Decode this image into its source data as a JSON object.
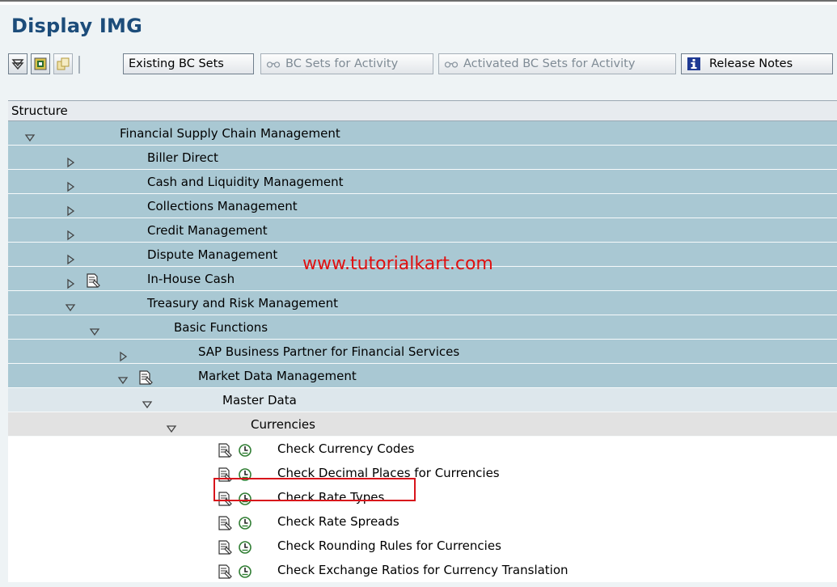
{
  "page_title": "Display IMG",
  "toolbar": {
    "buttons": [
      {
        "label": "Existing BC Sets",
        "enabled": true
      },
      {
        "label": "BC Sets for Activity",
        "enabled": false
      },
      {
        "label": "Activated BC Sets for Activity",
        "enabled": false
      },
      {
        "label": "Release Notes",
        "enabled": true
      }
    ]
  },
  "tree": {
    "header": "Structure",
    "rows": [
      {
        "label": "Financial Supply Chain Management",
        "expanded": true,
        "doc": false,
        "clock": false,
        "level": 0
      },
      {
        "label": "Biller Direct",
        "expanded": false,
        "doc": false,
        "clock": false,
        "level": 1
      },
      {
        "label": "Cash and Liquidity Management",
        "expanded": false,
        "doc": false,
        "clock": false,
        "level": 1
      },
      {
        "label": "Collections Management",
        "expanded": false,
        "doc": false,
        "clock": false,
        "level": 1
      },
      {
        "label": "Credit Management",
        "expanded": false,
        "doc": false,
        "clock": false,
        "level": 1
      },
      {
        "label": "Dispute Management",
        "expanded": false,
        "doc": false,
        "clock": false,
        "level": 1
      },
      {
        "label": "In-House Cash",
        "expanded": false,
        "doc": true,
        "clock": false,
        "level": 1
      },
      {
        "label": "Treasury and Risk Management",
        "expanded": true,
        "doc": false,
        "clock": false,
        "level": 1
      },
      {
        "label": "Basic Functions",
        "expanded": true,
        "doc": false,
        "clock": false,
        "level": 2
      },
      {
        "label": "SAP Business Partner for Financial Services",
        "expanded": false,
        "doc": false,
        "clock": false,
        "level": 3
      },
      {
        "label": "Market Data Management",
        "expanded": true,
        "doc": true,
        "clock": false,
        "level": 3
      },
      {
        "label": "Master Data",
        "expanded": true,
        "doc": false,
        "clock": false,
        "level": 4
      },
      {
        "label": "Currencies",
        "expanded": true,
        "doc": false,
        "clock": false,
        "level": 5
      },
      {
        "label": "Check Currency Codes",
        "doc": true,
        "clock": true,
        "level": 6
      },
      {
        "label": "Check Decimal Places for Currencies",
        "doc": true,
        "clock": true,
        "level": 6
      },
      {
        "label": "Check Rate Types",
        "doc": true,
        "clock": true,
        "level": 6,
        "highlighted": true
      },
      {
        "label": "Check Rate Spreads",
        "doc": true,
        "clock": true,
        "level": 6
      },
      {
        "label": "Check Rounding Rules for Currencies",
        "doc": true,
        "clock": true,
        "level": 6
      },
      {
        "label": "Check Exchange Ratios for Currency Translation",
        "doc": true,
        "clock": true,
        "level": 6
      }
    ]
  },
  "watermark": "www.tutorialkart.com",
  "colors": {
    "title": "#1c4c7a",
    "row_blue": "#a9c8d3",
    "row_light": "#dde7ec",
    "row_gray": "#e2e2e2",
    "highlight": "#d8141b",
    "watermark": "#e01010"
  }
}
